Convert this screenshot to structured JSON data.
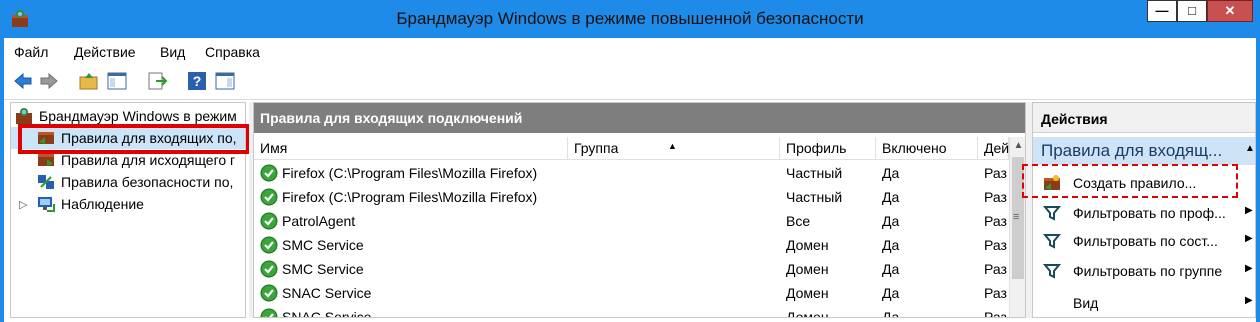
{
  "window": {
    "title": "Брандмауэр Windows в режиме повышенной безопасности",
    "min_glyph": "—",
    "max_glyph": "□",
    "close_glyph": "✕"
  },
  "menu": {
    "items": [
      "Файл",
      "Действие",
      "Вид",
      "Справка"
    ]
  },
  "toolbar": {
    "icons": [
      "back-arrow-icon",
      "forward-arrow-icon",
      "up-folder-icon",
      "show-hide-tree-icon",
      "export-list-icon",
      "help-icon",
      "show-hide-action-pane-icon"
    ]
  },
  "tree": {
    "items": [
      {
        "label": "Брандмауэр Windows в режим",
        "icon": "firewall-icon"
      },
      {
        "label": "Правила для входящих по,",
        "icon": "inbound-rules-icon"
      },
      {
        "label": "Правила для исходящего г",
        "icon": "outbound-rules-icon"
      },
      {
        "label": "Правила безопасности по,",
        "icon": "security-rules-icon"
      },
      {
        "label": "Наблюдение",
        "icon": "monitoring-icon",
        "expander": "▷"
      }
    ]
  },
  "center": {
    "header": "Правила для входящих подключений",
    "columns": [
      "Имя",
      "Группа",
      "Профиль",
      "Включено",
      "Дей"
    ],
    "sort_glyph": "▲",
    "rows": [
      {
        "name": "Firefox (C:\\Program Files\\Mozilla Firefox)",
        "group": "",
        "profile": "Частный",
        "enabled": "Да",
        "action": "Раз"
      },
      {
        "name": "Firefox (C:\\Program Files\\Mozilla Firefox)",
        "group": "",
        "profile": "Частный",
        "enabled": "Да",
        "action": "Раз"
      },
      {
        "name": "PatrolAgent",
        "group": "",
        "profile": "Все",
        "enabled": "Да",
        "action": "Раз"
      },
      {
        "name": "SMC Service",
        "group": "",
        "profile": "Домен",
        "enabled": "Да",
        "action": "Раз"
      },
      {
        "name": "SMC Service",
        "group": "",
        "profile": "Домен",
        "enabled": "Да",
        "action": "Раз"
      },
      {
        "name": "SNAC Service",
        "group": "",
        "profile": "Домен",
        "enabled": "Да",
        "action": "Раз"
      },
      {
        "name": "SNAC Service",
        "group": "",
        "profile": "Домен",
        "enabled": "Да",
        "action": "Раз"
      }
    ],
    "scroll_up_glyph": "▲",
    "scroll_grip": "≡"
  },
  "actions": {
    "title": "Действия",
    "section": "Правила для входящ...",
    "section_caret": "▲",
    "items": [
      {
        "label": "Создать правило...",
        "icon": "new-rule-icon",
        "submenu": ""
      },
      {
        "label": "Фильтровать по проф...",
        "icon": "filter-icon",
        "submenu": "▶"
      },
      {
        "label": "Фильтровать по сост...",
        "icon": "filter-icon",
        "submenu": "▶"
      },
      {
        "label": "Фильтровать по группе",
        "icon": "filter-icon",
        "submenu": "▶"
      },
      {
        "label": "Вид",
        "icon": "",
        "submenu": "▶"
      }
    ]
  },
  "colors": {
    "title_bar": "#1f8be8",
    "pane_header": "#7e7e7e",
    "highlight": "#e00000",
    "section_bg": "#cfe3f7"
  }
}
